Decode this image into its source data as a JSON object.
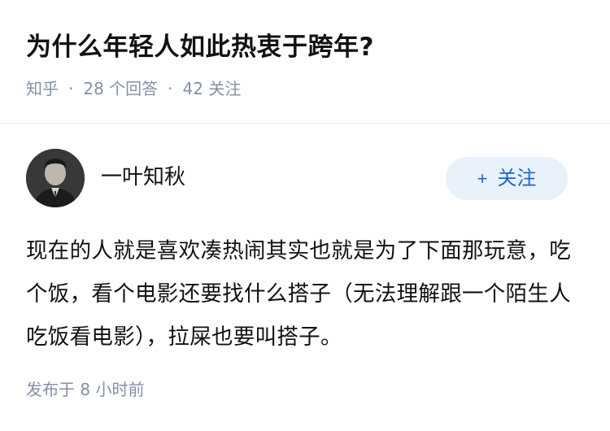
{
  "question": {
    "title": "为什么年轻人如此热衷于跨年?",
    "source": "知乎",
    "answer_count_text": "28  个回答",
    "follower_count_text": "42  关注",
    "separator": "·"
  },
  "author": {
    "name": "一叶知秋",
    "follow_button": {
      "icon_text": "+",
      "label": "关注"
    }
  },
  "answer": {
    "text": "现在的人就是喜欢凑热闹其实也就是为了下面那玩意，吃个饭，看个电影还要找什么搭子（无法理解跟一个陌生人吃饭看电影），拉屎也要叫搭子。"
  },
  "publish": {
    "time_text": "发布于  8 小时前"
  },
  "colors": {
    "text_primary": "#121212",
    "text_secondary": "#8590a6",
    "accent": "#1966d2",
    "button_bg": "#e9f1fb",
    "divider": "#ebebeb"
  },
  "icons": {
    "avatar": "user-avatar-photo",
    "follow": "plus-icon"
  }
}
